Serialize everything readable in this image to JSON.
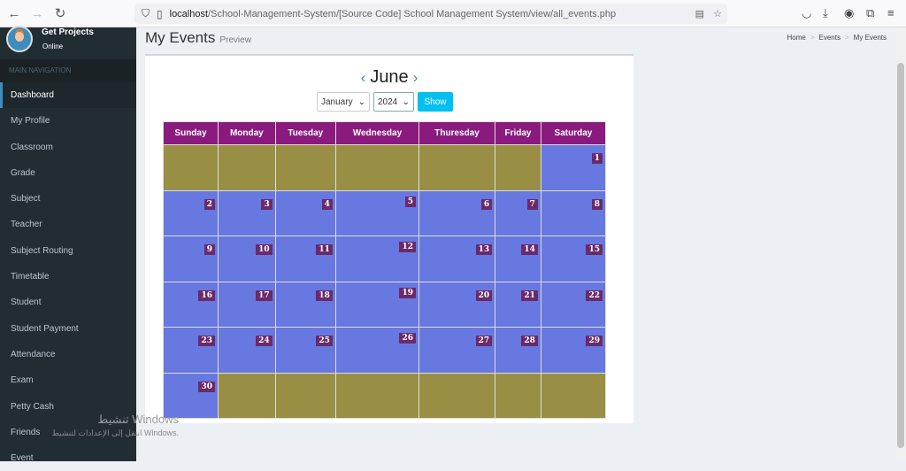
{
  "browser": {
    "url_host": "localhost",
    "url_path": "/School-Management-System/[Source Code] School Management System/view/all_events.php"
  },
  "user": {
    "name": "Get Projects",
    "status": "Online"
  },
  "sidebar": {
    "header": "MAIN NAVIGATION",
    "items": [
      "Dashboard",
      "My Profile",
      "Classroom",
      "Grade",
      "Subject",
      "Teacher",
      "Subject Routing",
      "Timetable",
      "Student",
      "Student Payment",
      "Attendance",
      "Exam",
      "Petty Cash",
      "Friends",
      "Event"
    ]
  },
  "page": {
    "title": "My Events",
    "subtitle": "Preview"
  },
  "breadcrumb": [
    "Home",
    "Events",
    "My Events"
  ],
  "calendar": {
    "month": "June",
    "prev": "‹",
    "next": "›",
    "month_select": "January",
    "year_select": "2024",
    "show_label": "Show",
    "days": [
      "Sunday",
      "Monday",
      "Tuesday",
      "Wednesday",
      "Thuresday",
      "Friday",
      "Saturday"
    ],
    "weeks": [
      [
        null,
        null,
        null,
        null,
        null,
        null,
        1
      ],
      [
        2,
        3,
        4,
        5,
        6,
        7,
        8
      ],
      [
        9,
        10,
        11,
        12,
        13,
        14,
        15
      ],
      [
        16,
        17,
        18,
        19,
        20,
        21,
        22
      ],
      [
        23,
        24,
        25,
        26,
        27,
        28,
        29
      ],
      [
        30,
        null,
        null,
        null,
        null,
        null,
        null
      ]
    ],
    "colors": {
      "header": "#8b1a7f",
      "day": "#6778e0",
      "empty": "#988f45"
    }
  },
  "watermark": {
    "line1": "تنشيط Windows",
    "line2": "انتقل إلى الإعدادات لتنشيط Windows."
  }
}
